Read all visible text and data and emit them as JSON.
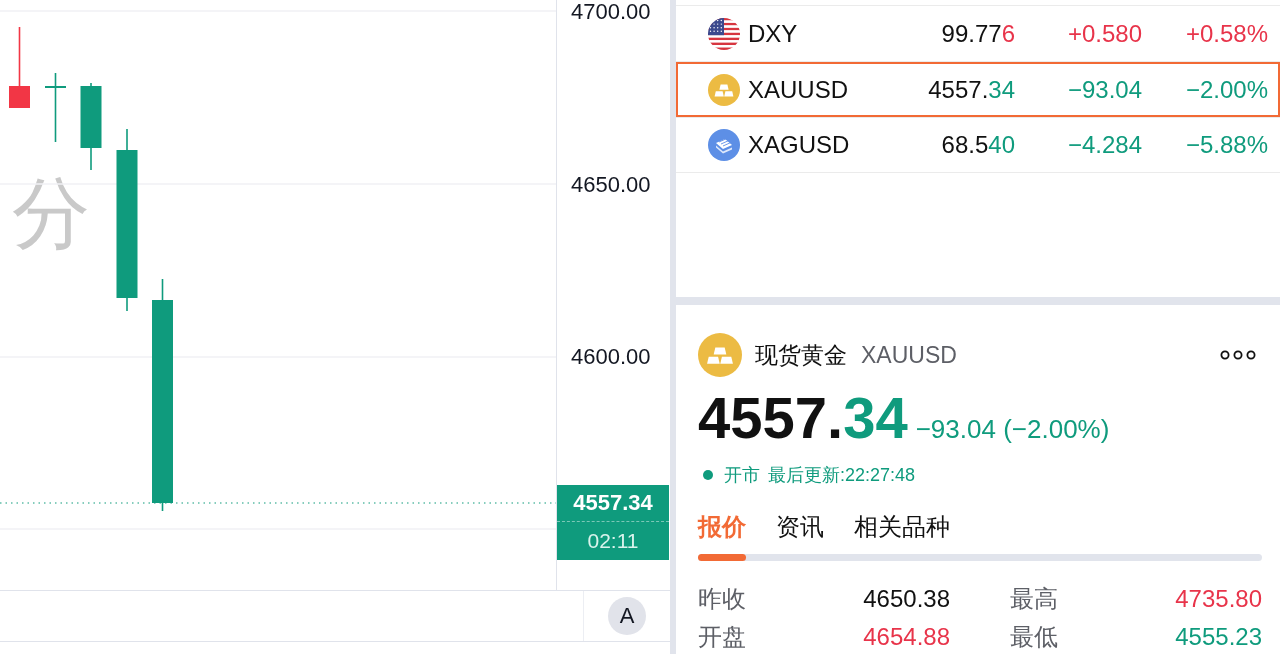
{
  "chart": {
    "watermark": "分",
    "price_axis": [
      "4700.00",
      "4650.00",
      "4600.00"
    ],
    "last_price": "4557.34",
    "countdown": "02:11",
    "scale_button": "A"
  },
  "watchlist": [
    {
      "kind": "dollar_index",
      "symbol": "DXY",
      "price_head": "99.77",
      "price_tail": "6",
      "change": "+0.580",
      "percent": "+0.58%",
      "color": "#e8344a",
      "selected": false
    },
    {
      "kind": "gold",
      "symbol": "XAUUSD",
      "price_head": "4557.",
      "price_tail": "34",
      "change": "−93.04",
      "percent": "−2.00%",
      "color": "#0f9b7d",
      "selected": true
    },
    {
      "kind": "silver",
      "symbol": "XAGUSD",
      "price_head": "68.5",
      "price_tail": "40",
      "change": "−4.284",
      "percent": "−5.88%",
      "color": "#0f9b7d",
      "selected": false
    }
  ],
  "detail": {
    "name": "现货黄金",
    "symbol": "XAUUSD",
    "price_head": "4557.",
    "price_tail": "34",
    "change": "−93.04 (−2.00%)",
    "color": "#0f9b7d",
    "market_open": true,
    "market_status": "开市",
    "updated": "最后更新:22:27:48",
    "tabs": [
      {
        "label": "报价",
        "selected": true
      },
      {
        "label": "资讯",
        "selected": false
      },
      {
        "label": "相关品种",
        "selected": false
      }
    ],
    "stats": [
      {
        "label": "昨收",
        "value": "4650.38",
        "color": "#111111"
      },
      {
        "label": "最高",
        "value": "4735.80",
        "color": "#e8344a"
      },
      {
        "label": "开盘",
        "value": "4654.88",
        "color": "#e8344a"
      },
      {
        "label": "最低",
        "value": "4555.23",
        "color": "#0f9b7d"
      }
    ]
  }
}
